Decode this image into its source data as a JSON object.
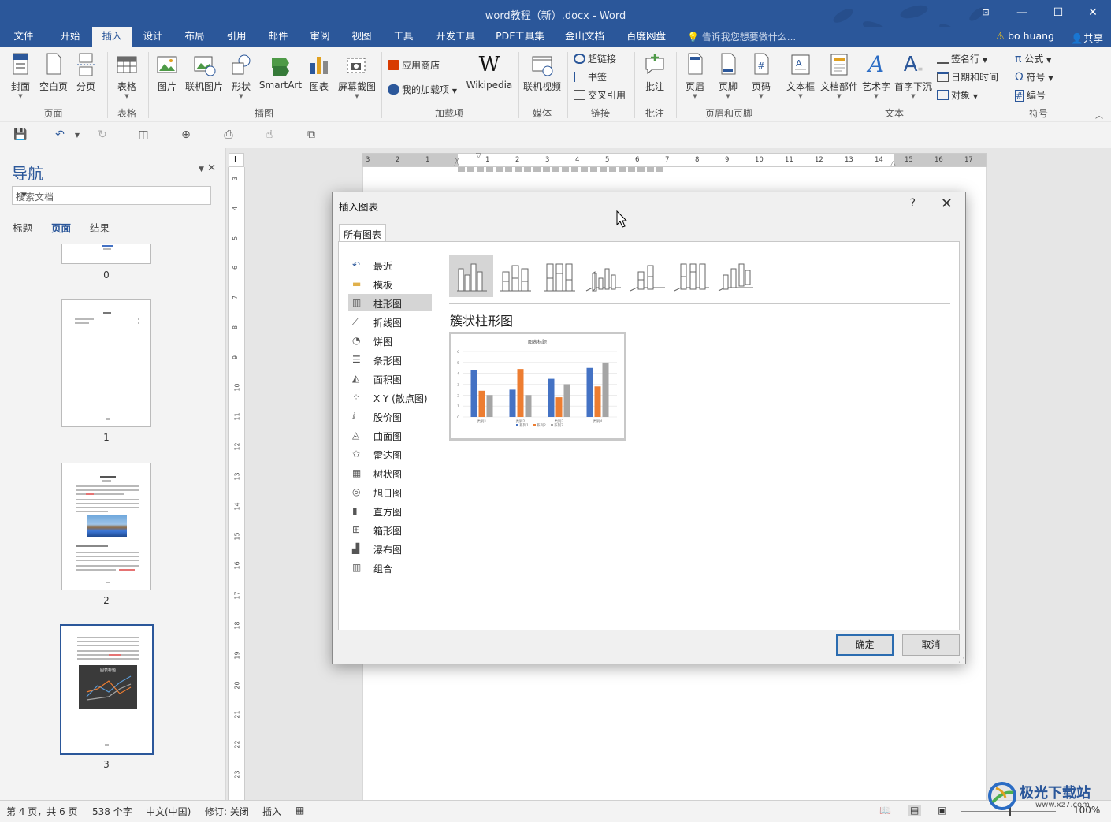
{
  "window": {
    "title": "word教程（新）.docx - Word",
    "controls": [
      "⊡",
      "—",
      "☐",
      "✕"
    ]
  },
  "tabs": [
    "文件",
    "开始",
    "插入",
    "设计",
    "布局",
    "引用",
    "邮件",
    "审阅",
    "视图",
    "工具",
    "开发工具",
    "PDF工具集",
    "金山文档",
    "百度网盘"
  ],
  "active_tab": "插入",
  "tell_me": "告诉我您想要做什么...",
  "user": "bo huang",
  "share": "共享",
  "ribbon": {
    "pages": {
      "cover": "封面",
      "blank": "空白页",
      "break": "分页",
      "group": "页面"
    },
    "tables": {
      "table": "表格",
      "group": "表格"
    },
    "illustrations": {
      "picture": "图片",
      "online_picture": "联机图片",
      "shapes": "形状",
      "smartart": "SmartArt",
      "chart": "图表",
      "screenshot": "屏幕截图",
      "group": "插图"
    },
    "addins": {
      "store": "应用商店",
      "my_addins": "我的加载项",
      "wikipedia": "Wikipedia",
      "group": "加载项"
    },
    "media": {
      "online_video": "联机视频",
      "group": "媒体"
    },
    "links": {
      "hyperlink": "超链接",
      "bookmark": "书签",
      "cross_ref": "交叉引用",
      "group": "链接"
    },
    "comments": {
      "comment": "批注",
      "group": "批注"
    },
    "header_footer": {
      "header": "页眉",
      "footer": "页脚",
      "page_number": "页码",
      "group": "页眉和页脚"
    },
    "text": {
      "textbox": "文本框",
      "quick_parts": "文档部件",
      "wordart": "艺术字",
      "dropcap": "首字下沉",
      "signature": "签名行",
      "datetime": "日期和时间",
      "object": "对象",
      "group": "文本"
    },
    "symbols": {
      "equation": "公式",
      "symbol": "符号",
      "number": "编号",
      "group": "符号"
    }
  },
  "navigation": {
    "title": "导航",
    "search_placeholder": "搜索文档",
    "tabs": [
      "标题",
      "页面",
      "结果"
    ],
    "active_tab": "页面",
    "pages": [
      "0",
      "1",
      "2",
      "3"
    ],
    "thumb_title": "图表标题"
  },
  "ruler": {
    "h": [
      "3",
      "2",
      "1",
      "",
      "1",
      "2",
      "3",
      "4",
      "5",
      "6",
      "7",
      "8",
      "9",
      "10",
      "11",
      "12",
      "13",
      "14",
      "15",
      "16",
      "17"
    ],
    "v": [
      "3",
      "4",
      "5",
      "6",
      "7",
      "8",
      "9",
      "10",
      "11",
      "12",
      "13",
      "14",
      "15",
      "16",
      "17",
      "18",
      "19",
      "20",
      "21",
      "22",
      "23"
    ],
    "corner": "L"
  },
  "dialog": {
    "title": "插入图表",
    "help": "?",
    "tab": "所有图表",
    "types": [
      "最近",
      "模板",
      "柱形图",
      "折线图",
      "饼图",
      "条形图",
      "面积图",
      "X Y (散点图)",
      "股价图",
      "曲面图",
      "雷达图",
      "树状图",
      "旭日图",
      "直方图",
      "箱形图",
      "瀑布图",
      "组合"
    ],
    "selected_type": "柱形图",
    "subtype_title": "簇状柱形图",
    "preview_title": "图表标题",
    "ok": "确定",
    "cancel": "取消"
  },
  "chart_data": {
    "type": "bar",
    "title": "图表标题",
    "categories": [
      "类别1",
      "类别2",
      "类别3",
      "类别4"
    ],
    "series": [
      {
        "name": "系列1",
        "values": [
          4.3,
          2.5,
          3.5,
          4.5
        ],
        "color": "#4472c4"
      },
      {
        "name": "系列2",
        "values": [
          2.4,
          4.4,
          1.8,
          2.8
        ],
        "color": "#ed7d31"
      },
      {
        "name": "系列3",
        "values": [
          2,
          2,
          3,
          5
        ],
        "color": "#a5a5a5"
      }
    ],
    "ylim": [
      0,
      6
    ],
    "yticks": [
      "0",
      "1",
      "2",
      "3",
      "4",
      "5",
      "6"
    ],
    "grid": true,
    "legend": "bottom"
  },
  "status": {
    "page": "第 4 页，共 6 页",
    "words": "538 个字",
    "lang": "中文(中国)",
    "track": "修订: 关闭",
    "mode": "插入",
    "zoom": "100%"
  },
  "watermark": "极光下载站",
  "watermark_url": "www.xz7.com"
}
